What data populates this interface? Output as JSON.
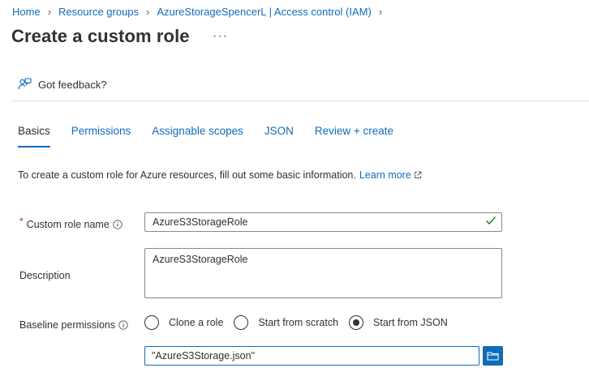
{
  "breadcrumb": [
    "Home",
    "Resource groups",
    "AzureStorageSpencerL | Access control (IAM)"
  ],
  "page_title": "Create a custom role",
  "more_label": "···",
  "feedback_label": "Got feedback?",
  "tabs": [
    {
      "label": "Basics",
      "active": true
    },
    {
      "label": "Permissions",
      "active": false
    },
    {
      "label": "Assignable scopes",
      "active": false
    },
    {
      "label": "JSON",
      "active": false
    },
    {
      "label": "Review + create",
      "active": false
    }
  ],
  "intro": {
    "text": "To create a custom role for Azure resources, fill out some basic information.",
    "learn_more": "Learn more"
  },
  "form": {
    "role_name": {
      "required_mark": "*",
      "label": "Custom role name",
      "value": "AzureS3StorageRole"
    },
    "description": {
      "label": "Description",
      "value": "AzureS3StorageRole"
    },
    "baseline": {
      "label": "Baseline permissions",
      "options": [
        {
          "label": "Clone a role",
          "checked": false
        },
        {
          "label": "Start from scratch",
          "checked": false
        },
        {
          "label": "Start from JSON",
          "checked": true
        }
      ],
      "json_file": "\"AzureS3Storage.json\""
    }
  },
  "colors": {
    "accent": "#0f6cbd",
    "success": "#107c10",
    "required": "#a4262c",
    "text": "#323130"
  }
}
